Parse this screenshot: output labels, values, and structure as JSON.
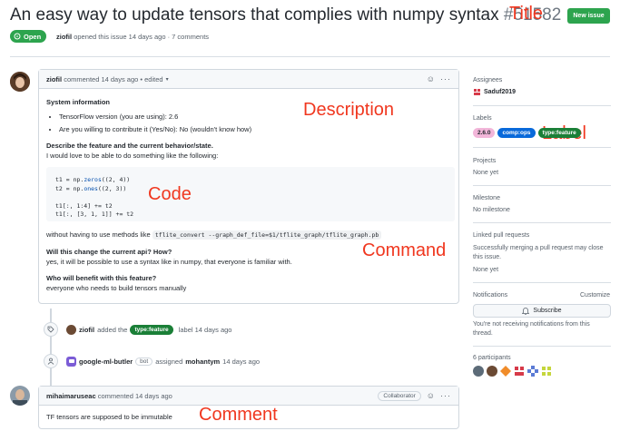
{
  "issue": {
    "title": "An easy way to update tensors that complies with numpy syntax",
    "number": "#51582",
    "new_issue_label": "New issue",
    "state": "Open",
    "author": "ziofil",
    "meta": "opened this issue 14 days ago · 7 comments"
  },
  "annotations": {
    "title": "Title",
    "description": "Description",
    "label": "Label",
    "code": "Code",
    "command": "Command",
    "comment": "Comment"
  },
  "main_comment": {
    "author": "ziofil",
    "meta": "commented 14 days ago • edited",
    "heading": "System information",
    "bullets": [
      "TensorFlow version (you are using): 2.6",
      "Are you willing to contribute it (Yes/No): No (wouldn't know how)"
    ],
    "q1": "Describe the feature and the current behavior/state.",
    "a1": "I would love to be able to do something like the following:",
    "code_lines": [
      "t1 = np.zeros((2, 4))",
      "t2 = np.ones((2, 3))",
      "",
      "t1[:, 1:4] += t2",
      "t1[:, [3, 1, 1]] += t2"
    ],
    "without_prefix": "without having to use methods like",
    "without_code": "tflite_convert --graph_def_file=$1/tflite_graph/tflite_graph.pb",
    "q2": "Will this change the current api? How?",
    "a2": "yes, it will be possible to use a syntax like in numpy, that everyone is familiar with.",
    "q3": "Who will benefit with this feature?",
    "a3": "everyone who needs to build tensors manually"
  },
  "timeline": {
    "label_event_user": "ziofil",
    "label_event_pre": "added the",
    "label_event_label": "type:feature",
    "label_event_post": "label 14 days ago",
    "assign_user": "google-ml-butler",
    "assign_bot": "bot",
    "assign_pre": "assigned",
    "assign_target": "mohantym",
    "assign_post": "14 days ago"
  },
  "second_comment": {
    "author": "mihaimaruseac",
    "meta": "commented 14 days ago",
    "badge": "Collaborator",
    "text": "TF tensors are supposed to be immutable"
  },
  "sidebar": {
    "assignees_h": "Assignees",
    "assignee": "Saduf2019",
    "labels_h": "Labels",
    "labels": [
      {
        "text": "2.6.0",
        "bg": "#f2b6d9",
        "fg": "#24292f"
      },
      {
        "text": "comp:ops",
        "bg": "#0969da",
        "fg": "#ffffff"
      },
      {
        "text": "type:feature",
        "bg": "#1a7f37",
        "fg": "#ffffff"
      }
    ],
    "projects_h": "Projects",
    "projects_v": "None yet",
    "milestone_h": "Milestone",
    "milestone_v": "No milestone",
    "linked_h": "Linked pull requests",
    "linked_d1": "Successfully merging a pull request may close",
    "linked_d2": "this issue.",
    "linked_v": "None yet",
    "notif_h": "Notifications",
    "customize": "Customize",
    "subscribe": "Subscribe",
    "notif_d1": "You're not receiving notifications from this",
    "notif_d2": "thread.",
    "participants_h": "6 participants"
  },
  "colors": {
    "accent_green": "#2da44e",
    "annotation_red": "#f0371f",
    "link_blue": "#0969da"
  }
}
